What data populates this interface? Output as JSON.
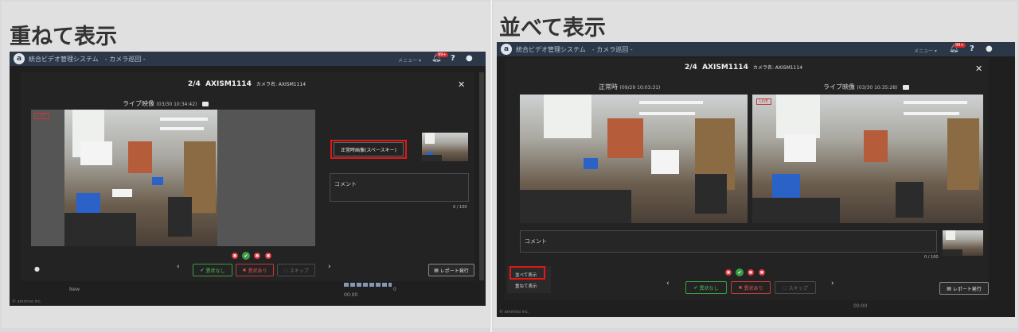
{
  "left_panel": {
    "heading": "重ねて表示",
    "app": {
      "title": "統合ビデオ管理システム　- カメラ巡回 -",
      "menu_label": "メニュー ▾",
      "badge": "99+",
      "help": "?"
    },
    "modal": {
      "counter": "2/4",
      "camera_id": "AXISM1114",
      "camera_name": "カメラ名: AXISM1114",
      "live_label": "ライブ映像",
      "live_timestamp": "(03/30 10:34:42)",
      "live_tag": "LIVE",
      "normal_image_button": "正常時画像(スペースキー)",
      "comment_placeholder": "コメント",
      "comment_counter": "0 / 100"
    },
    "actions": {
      "no_anomaly": "異状なし",
      "anomaly": "異状あり",
      "skip": "スキップ",
      "report": "レポート発行"
    },
    "background_row": {
      "label": "New",
      "time": "00:00",
      "count": "0"
    },
    "footer": "© ammino inc."
  },
  "right_panel": {
    "heading": "並べて表示",
    "app": {
      "title": "統合ビデオ管理システム　- カメラ巡回 -",
      "menu_label": "メニュー ▾",
      "badge": "99+",
      "help": "?"
    },
    "modal": {
      "counter": "2/4",
      "camera_id": "AXISM1114",
      "camera_name": "カメラ名: AXISM1114",
      "normal_label": "正常時",
      "normal_timestamp": "(09/29 10:03:31)",
      "live_label": "ライブ映像",
      "live_timestamp": "(03/30 10:35:28)",
      "live_tag": "LIVE",
      "comment_placeholder": "コメント",
      "comment_counter": "0 / 100"
    },
    "view_toggle": {
      "side_by_side": "並べて表示",
      "overlay": "重ねて表示"
    },
    "actions": {
      "no_anomaly": "異状なし",
      "anomaly": "異状あり",
      "skip": "スキップ",
      "report": "レポート発行"
    },
    "background_time": "00:00",
    "footer": "© ammino inc."
  },
  "icons": {
    "close": "✕",
    "check": "✔",
    "cross": "✖",
    "prev": "‹",
    "next": "›",
    "report": "▤",
    "eye_off": "◌"
  },
  "colors": {
    "appbar": "#2c3848",
    "highlight": "#e01818",
    "ok_green": "#3c9b45",
    "ng_red": "#e0393e"
  }
}
